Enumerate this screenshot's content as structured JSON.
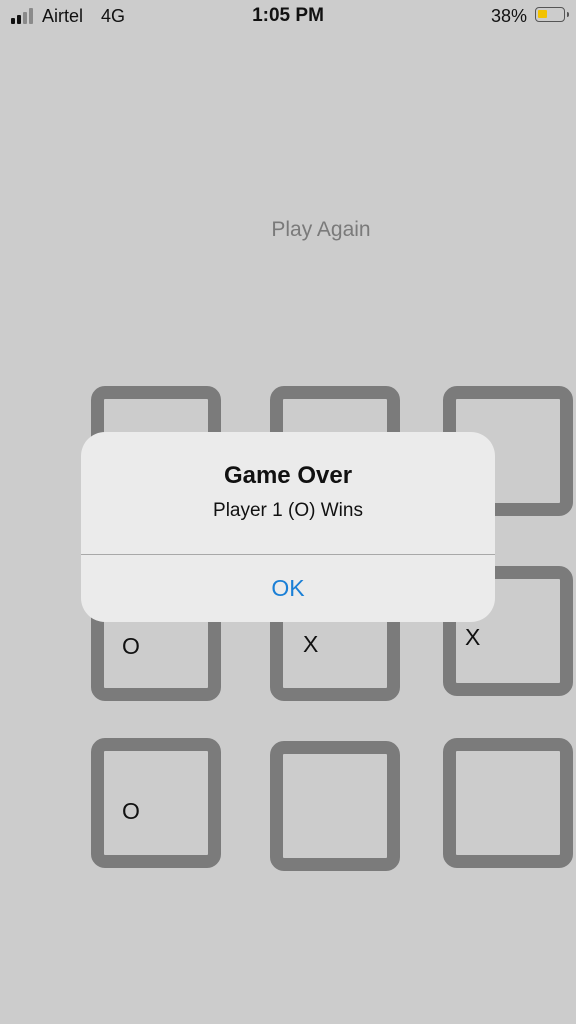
{
  "status_bar": {
    "carrier": "Airtel",
    "network": "4G",
    "time": "1:05 PM",
    "battery_percent": "38%",
    "battery_level": 0.38,
    "battery_color": "#f2c200",
    "signal_bars": 2
  },
  "play_again_label": "Play Again",
  "board": {
    "cells": [
      {
        "mark": ""
      },
      {
        "mark": ""
      },
      {
        "mark": ""
      },
      {
        "mark": "O"
      },
      {
        "mark": "X"
      },
      {
        "mark": "X"
      },
      {
        "mark": "O"
      },
      {
        "mark": ""
      },
      {
        "mark": ""
      }
    ]
  },
  "alert": {
    "title": "Game Over",
    "message": "Player 1 (O) Wins",
    "ok_label": "OK"
  },
  "colors": {
    "background": "#cccccc",
    "cell_border": "#7b7b7b",
    "alert_button": "#1a7fd6"
  }
}
